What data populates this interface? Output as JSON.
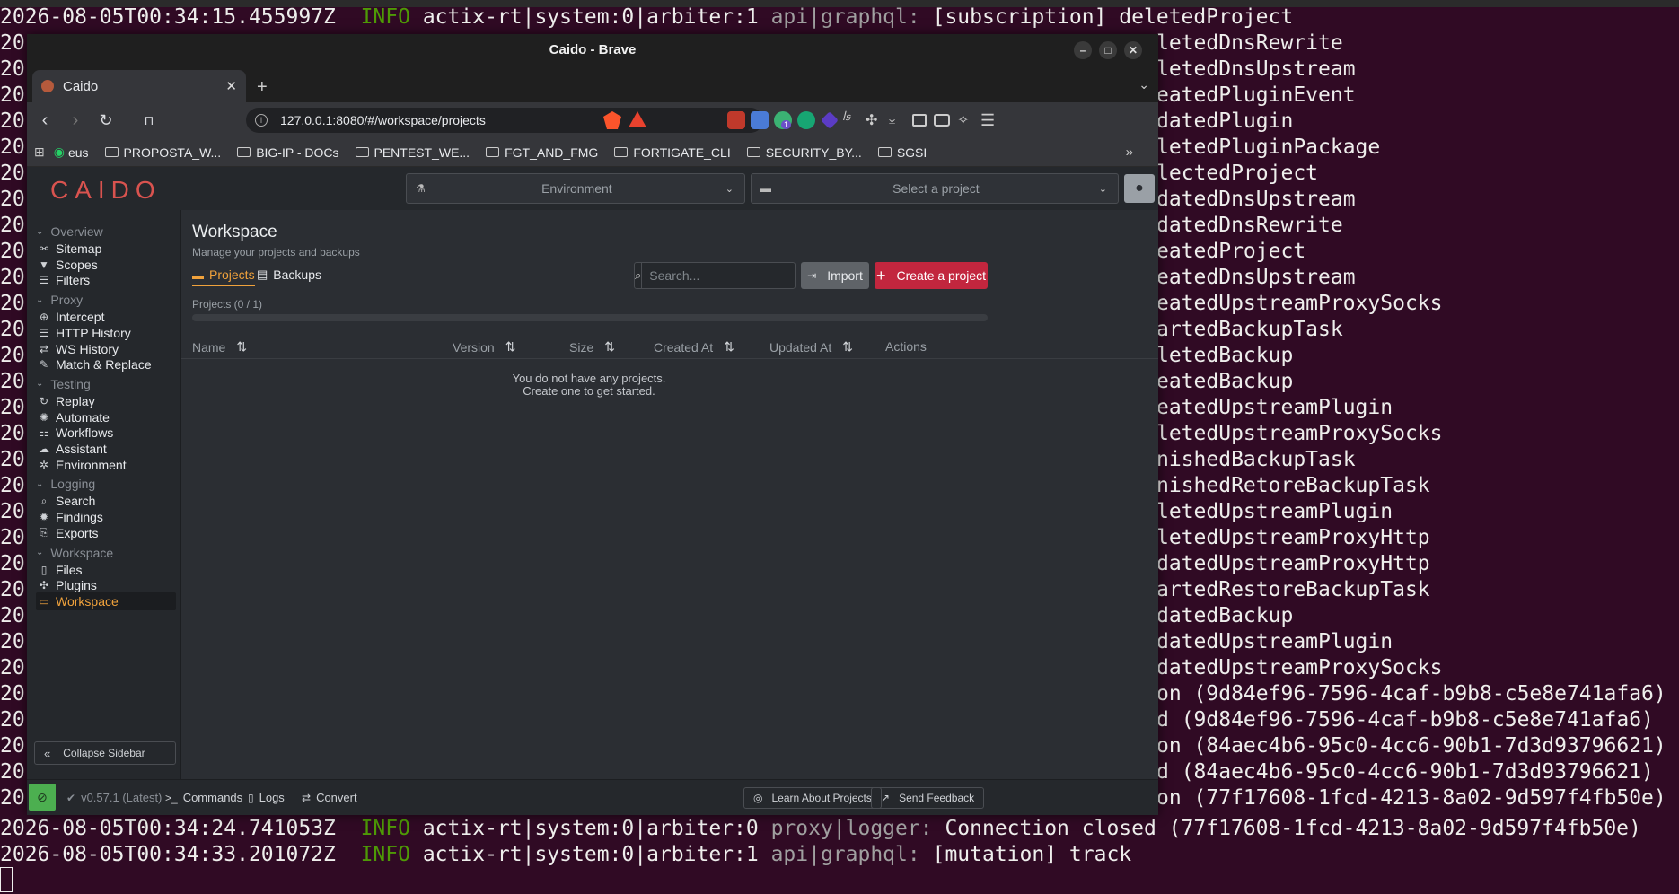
{
  "terminal": {
    "top_line": {
      "ts": "2026-08-05T00:34:15.455997Z",
      "level": "INFO",
      "target": "actix-rt|system:0|arbiter:1",
      "module": "api|graphql:",
      "msg": "[subscription] deletedProject"
    },
    "prefix": "20",
    "right_lines": [
      "letedDnsRewrite",
      "letedDnsUpstream",
      "eatedPluginEvent",
      "datedPlugin",
      "letedPluginPackage",
      "lectedProject",
      "datedDnsUpstream",
      "datedDnsRewrite",
      "eatedProject",
      "eatedDnsUpstream",
      "eatedUpstreamProxySocks",
      "artedBackupTask",
      "letedBackup",
      "eatedBackup",
      "eatedUpstreamPlugin",
      "letedUpstreamProxySocks",
      "nishedBackupTask",
      "nishedRetoreBackupTask",
      "letedUpstreamPlugin",
      "letedUpstreamProxyHttp",
      "datedUpstreamProxyHttp",
      "artedRestoreBackupTask",
      "datedBackup",
      "datedUpstreamPlugin",
      "datedUpstreamProxySocks",
      "on (9d84ef96-7596-4caf-b9b8-c5e8e741afa6)",
      "d (9d84ef96-7596-4caf-b9b8-c5e8e741afa6)",
      "on (84aec4b6-95c0-4cc6-90b1-7d3d93796621)",
      "d (84aec4b6-95c0-4cc6-90b1-7d3d93796621)",
      "on (77f17608-1fcd-4213-8a02-9d597f4fb50e)"
    ],
    "bottom_lines": [
      {
        "ts": "2026-08-05T00:34:24.741053Z",
        "level": "INFO",
        "target": "actix-rt|system:0|arbiter:0",
        "module": "proxy|logger:",
        "msg": "Connection closed (77f17608-1fcd-4213-8a02-9d597f4fb50e)"
      },
      {
        "ts": "2026-08-05T00:34:33.201072Z",
        "level": "INFO",
        "target": "actix-rt|system:0|arbiter:1",
        "module": "api|graphql:",
        "msg": "[mutation] track"
      }
    ]
  },
  "browser": {
    "window_title": "Caido - Brave",
    "tab_title": "Caido",
    "url": "127.0.0.1:8080/#/workspace/projects",
    "bookmarks": [
      "eus",
      "PROPOSTA_W...",
      "BIG-IP - DOCs",
      "PENTEST_WE...",
      "FGT_AND_FMG",
      "FORTIGATE_CLI",
      "SECURITY_BY...",
      "SGSI"
    ],
    "ext_badge": "1"
  },
  "app": {
    "logo": "CAIDO",
    "environment_placeholder": "Environment",
    "project_placeholder": "Select a project",
    "sidebar": {
      "groups": [
        {
          "label": "Overview",
          "items": [
            {
              "label": "Sitemap",
              "icon": "sitemap-icon"
            },
            {
              "label": "Scopes",
              "icon": "scopes-icon"
            },
            {
              "label": "Filters",
              "icon": "filters-icon"
            }
          ]
        },
        {
          "label": "Proxy",
          "items": [
            {
              "label": "Intercept",
              "icon": "intercept-icon"
            },
            {
              "label": "HTTP History",
              "icon": "list-icon"
            },
            {
              "label": "WS History",
              "icon": "ws-icon"
            },
            {
              "label": "Match & Replace",
              "icon": "wrench-icon"
            }
          ]
        },
        {
          "label": "Testing",
          "items": [
            {
              "label": "Replay",
              "icon": "replay-icon"
            },
            {
              "label": "Automate",
              "icon": "automate-icon"
            },
            {
              "label": "Workflows",
              "icon": "workflows-icon"
            },
            {
              "label": "Assistant",
              "icon": "assistant-icon"
            },
            {
              "label": "Environment",
              "icon": "environment-icon"
            }
          ]
        },
        {
          "label": "Logging",
          "items": [
            {
              "label": "Search",
              "icon": "search-icon"
            },
            {
              "label": "Findings",
              "icon": "findings-icon"
            },
            {
              "label": "Exports",
              "icon": "exports-icon"
            }
          ]
        },
        {
          "label": "Workspace",
          "items": [
            {
              "label": "Files",
              "icon": "file-icon"
            },
            {
              "label": "Plugins",
              "icon": "plugins-icon"
            },
            {
              "label": "Workspace",
              "icon": "monitor-icon"
            }
          ]
        }
      ],
      "collapse_label": "Collapse Sidebar"
    },
    "page": {
      "title": "Workspace",
      "subtitle": "Manage your projects and backups",
      "tab_projects": "Projects",
      "tab_backups": "Backups",
      "search_placeholder": "Search...",
      "import_label": "Import",
      "create_label": "Create a project",
      "count_label": "Projects (0 / 1)",
      "progress": 0,
      "columns": [
        "Name",
        "Version",
        "Size",
        "Created At",
        "Updated At",
        "Actions"
      ],
      "empty_line1": "You do not have any projects.",
      "empty_line2": "Create one to get started."
    },
    "footer": {
      "version": "v0.57.1 (Latest)",
      "commands": "Commands",
      "logs": "Logs",
      "convert": "Convert",
      "learn": "Learn About Projects",
      "feedback": "Send Feedback"
    },
    "colors": {
      "accent": "#f0a23c",
      "create": "#c2263e",
      "status": "#4caf50",
      "logo": "#d9534f"
    }
  }
}
